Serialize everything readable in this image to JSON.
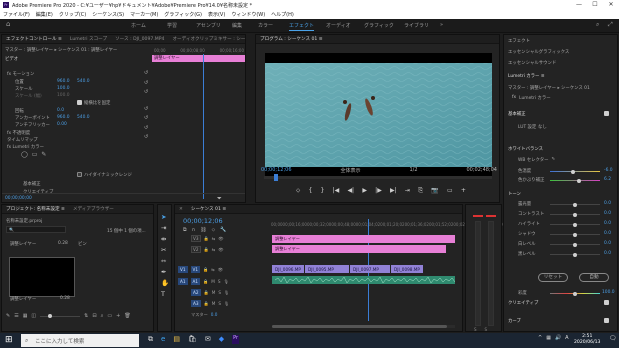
{
  "app": {
    "title": "Adobe Premiere Pro 2020 - C:¥ユーザー¥hp¥ドキュメント¥Adobe¥Premiere Pro¥14.0¥名称未設定 *",
    "min": "—",
    "max": "☐",
    "close": "✕"
  },
  "menu": [
    "ファイル(F)",
    "編集(E)",
    "クリップ(C)",
    "シーケンス(S)",
    "マーカー(M)",
    "グラフィック(G)",
    "表示(V)",
    "ウィンドウ(W)",
    "ヘルプ(H)"
  ],
  "workspaces": [
    "ホーム",
    "学習",
    "アセンブリ",
    "編集",
    "カラー",
    "エフェクト",
    "オーディオ",
    "グラフィック",
    "ライブラリ"
  ],
  "workspace_active": "エフェクト",
  "effect_controls": {
    "tabs": [
      "エフェクトコントロール ≡",
      "Lumetri スコープ",
      "ソース : DJI_0097.MP4",
      "オーディオクリップミキサー : シー"
    ],
    "source_line": "マスター : 調整レイヤー ▸ シーケンス 01 : 調整レイヤー",
    "section_video": "ビデオ",
    "ruler": [
      "00;00",
      "00;00;08;00",
      "00;00;16;00"
    ],
    "clip_name": "調整レイヤー",
    "rows": [
      {
        "label": "fx モーション",
        "indent": 0
      },
      {
        "label": "位置",
        "value": "960.0",
        "value2": "540.0",
        "indent": 2
      },
      {
        "label": "スケール",
        "value": "100.0",
        "indent": 2
      },
      {
        "label": "スケール (幅)",
        "value": "100.0",
        "indent": 2
      },
      {
        "label": "",
        "check": "縦横比を固定",
        "indent": 4
      },
      {
        "label": "回転",
        "value": "0.0",
        "indent": 2
      },
      {
        "label": "アンカーポイント",
        "value": "960.0",
        "value2": "540.0",
        "indent": 2
      },
      {
        "label": "アンチフリッカー",
        "value": "0.00",
        "indent": 2
      },
      {
        "label": "fx 不透明度",
        "indent": 0
      },
      {
        "label": "タイムリマップ",
        "indent": 0
      },
      {
        "label": "fx Lumetri カラー",
        "indent": 0
      },
      {
        "label": "",
        "check": "ハイダイナミックレンジ",
        "indent": 4
      },
      {
        "label": "基本補正",
        "indent": 2
      },
      {
        "label": "クリエイティブ",
        "indent": 2
      }
    ],
    "timecode": "00;00;00;00"
  },
  "program": {
    "tab": "プログラム : シーケンス 01 ≡",
    "timecode": "00;00;12;06",
    "fit": "全体表示",
    "quality": "1/2",
    "duration": "00;02;48;04",
    "transport": [
      "⬦",
      "{",
      "}",
      "|◀",
      "◀|",
      "▶",
      "|▶",
      "▶|",
      "⇥",
      "⎘",
      "📷",
      "▭",
      "+"
    ]
  },
  "project": {
    "tabs": [
      "プロジェクト: 名称未設定 ≡",
      "メディアブラウザー"
    ],
    "file": "名称未設定.prproj",
    "count": "15 個中 1 個の項...",
    "search_placeholder": "🔍",
    "col_name": "調整レイヤー",
    "col_fps": "0.28",
    "col2": "ビン",
    "item_name": "調整レイヤー",
    "item_dur": "0.28"
  },
  "timeline": {
    "tab": "シーケンス 01 ≡",
    "timecode": "00;00;12;06",
    "ruler": [
      "00;00",
      "00;00;16;00",
      "00;00;32;00",
      "00;00;48;00",
      "00;01;04;02",
      "00;01;20;02",
      "00;01;36;02",
      "00;01;52;02",
      "00;02;08;04",
      "00;02;24;04",
      "00;02;40;04"
    ],
    "tracks": [
      {
        "name": "V3",
        "src": ""
      },
      {
        "name": "V2",
        "src": ""
      },
      {
        "name": "V1",
        "src": "V1"
      },
      {
        "name": "A1",
        "src": "A1"
      },
      {
        "name": "A2",
        "src": ""
      },
      {
        "name": "A3",
        "src": ""
      },
      {
        "name": "マスター",
        "src": "",
        "value": "0.0"
      }
    ],
    "clips_v3": "調整レイヤー",
    "clips_v2": "調整レイヤー",
    "clips_v1": [
      "DJI_0096.MP",
      "DJI_0095.MP",
      "DJI_0097.MP",
      "DJI_0098.MP"
    ]
  },
  "lumetri": {
    "tabs": [
      "エフェクト",
      "エッセンシャルグラフィックス",
      "エッセンシャルサウンド",
      "Lumetri カラー ≡"
    ],
    "source": "マスター : 調整レイヤー ▸ シーケンス 01",
    "effect": "Lumetri カラー",
    "basic": "基本補正",
    "lut_label": "LUT 設定",
    "lut_value": "なし",
    "wb": "ホワイトバランス",
    "wb_selector": "WB セレクター",
    "temp": "色温度",
    "temp_val": "-6.0",
    "tint": "色かぶり補正",
    "tint_val": "6.2",
    "tone": "トーン",
    "sliders": [
      {
        "label": "露光量",
        "value": "0.0"
      },
      {
        "label": "コントラスト",
        "value": "0.0"
      },
      {
        "label": "ハイライト",
        "value": "0.0"
      },
      {
        "label": "シャドウ",
        "value": "0.0"
      },
      {
        "label": "白レベル",
        "value": "0.0"
      },
      {
        "label": "黒レベル",
        "value": "0.0"
      }
    ],
    "reset": "リセット",
    "auto": "自動",
    "saturation": "彩度",
    "saturation_val": "100.0",
    "creative": "クリエイティブ",
    "curves": "カーブ"
  },
  "taskbar": {
    "search": "ここに入力して検索",
    "time": "2:51",
    "date": "2020/06/13"
  }
}
